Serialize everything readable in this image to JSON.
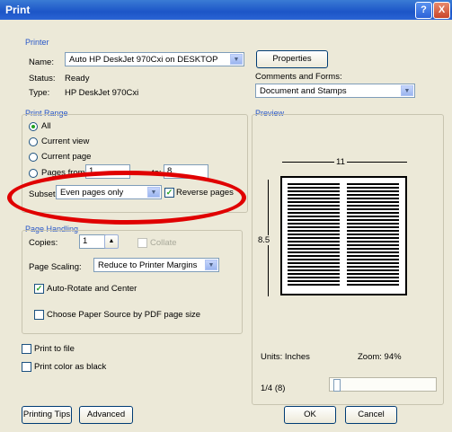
{
  "window": {
    "title": "Print",
    "help_btn": "?",
    "close_btn": "X"
  },
  "printer": {
    "group_label": "Printer",
    "name_label": "Name:",
    "name_value": "Auto HP DeskJet 970Cxi on DESKTOP",
    "status_label": "Status:",
    "status_value": "Ready",
    "type_label": "Type:",
    "type_value": "HP DeskJet 970Cxi",
    "properties_btn": "Properties",
    "comments_label": "Comments and Forms:",
    "comments_value": "Document and Stamps"
  },
  "print_range": {
    "group_label": "Print Range",
    "all": "All",
    "current_view": "Current view",
    "current_page": "Current page",
    "pages_from": "Pages from:",
    "from_value": "1",
    "to_label": "to:",
    "to_value": "8",
    "subset_label": "Subset:",
    "subset_value": "Even pages only",
    "reverse_label": "Reverse pages"
  },
  "page_handling": {
    "group_label": "Page Handling",
    "copies_label": "Copies:",
    "copies_value": "1",
    "collate_label": "Collate",
    "scaling_label": "Page Scaling:",
    "scaling_value": "Reduce to Printer Margins",
    "auto_rotate": "Auto-Rotate and Center",
    "choose_source": "Choose Paper Source by PDF page size"
  },
  "options": {
    "print_to_file": "Print to file",
    "print_color_black": "Print color as black"
  },
  "preview": {
    "group_label": "Preview",
    "width_label": "11",
    "height_label": "8.5",
    "units": "Units: Inches",
    "zoom": "Zoom: 94%",
    "page_counter": "1/4 (8)"
  },
  "buttons": {
    "printing_tips": "Printing Tips",
    "advanced": "Advanced",
    "ok": "OK",
    "cancel": "Cancel"
  },
  "colors": {
    "title_bar": "#1c55c7",
    "annotation": "#e00000",
    "group_label": "#2857c8"
  }
}
